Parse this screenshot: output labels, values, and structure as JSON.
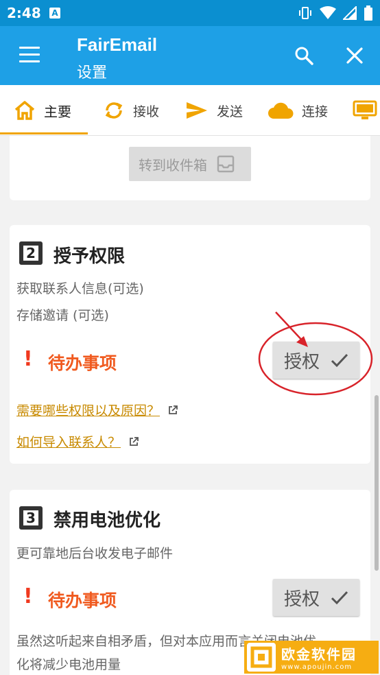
{
  "status_bar": {
    "time": "2:48",
    "notification_icon": "A"
  },
  "app_bar": {
    "title": "FairEmail",
    "subtitle": "设置"
  },
  "tabs": [
    {
      "label": "主要",
      "icon": "home-icon",
      "active": true
    },
    {
      "label": "接收",
      "icon": "sync-icon",
      "active": false
    },
    {
      "label": "发送",
      "icon": "send-icon",
      "active": false
    },
    {
      "label": "连接",
      "icon": "cloud-icon",
      "active": false
    },
    {
      "label": "",
      "icon": "display-icon",
      "active": false
    }
  ],
  "card1": {
    "inbox_button": "转到收件箱"
  },
  "card2": {
    "step": "2",
    "title": "授予权限",
    "lines": [
      "获取联系人信息(可选)",
      "存储邀请 (可选)"
    ],
    "todo_mark": "!",
    "todo": "待办事项",
    "grant_button": "授权",
    "link1": "需要哪些权限以及原因？",
    "link2": "如何导入联系人？"
  },
  "card3": {
    "step": "3",
    "title": "禁用电池优化",
    "line": "更可靠地后台收发电子邮件",
    "todo_mark": "!",
    "todo": "待办事项",
    "grant_button": "授权",
    "note": [
      "虽然这听起来自相矛盾，但对本应用而言关闭电池优",
      "化将减少电池用量"
    ]
  },
  "watermark": {
    "cn": "欧金软件园",
    "en": "www.apoujin.com"
  },
  "colors": {
    "appbar": "#1ea0e6",
    "statusbar": "#0b8fd0",
    "accent": "#f0a400",
    "todo": "#f05a1f",
    "link": "#c88a00",
    "annotation": "#d8232a"
  }
}
